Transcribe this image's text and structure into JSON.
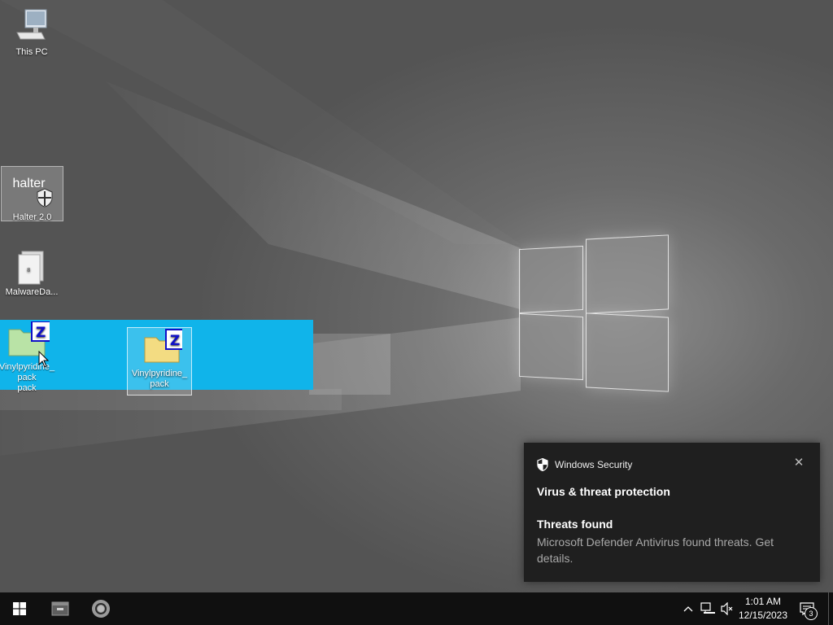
{
  "desktop": {
    "icons": {
      "this_pc": "This PC",
      "halter": "Halter 2.0",
      "halter_logo_text": "halter",
      "malware": "MalwareDa...",
      "vinyl_drag": "Vinylpyridine_\npack\npack",
      "vinyl": "Vinylpyridine_\npack"
    }
  },
  "toast": {
    "app_name": "Windows Security",
    "close_glyph": "✕",
    "title": "Virus & threat protection",
    "subtitle": "Threats found",
    "body": "Microsoft Defender Antivirus found threats. Get details."
  },
  "taskbar": {
    "time": "1:01 AM",
    "date": "12/15/2023",
    "notification_count": "3",
    "tray_chevron": "^"
  },
  "colors": {
    "highlight": "#10b4ea",
    "taskbar": "#101010",
    "toast_bg": "#1f1f1f"
  }
}
